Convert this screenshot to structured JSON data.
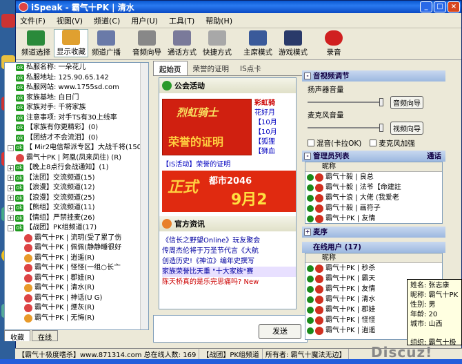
{
  "window": {
    "title": "iSpeak - 霸气十PK | 清水",
    "app_name": "iSpeak"
  },
  "menu": [
    "文件(F)",
    "视图(V)",
    "频道(C)",
    "用户(U)",
    "工具(T)",
    "帮助(H)"
  ],
  "toolbar": [
    "频道选择",
    "显示收藏",
    "频道广播",
    "音频向导",
    "通话方式",
    "快捷方式",
    "主席模式",
    "游戏模式",
    "录音"
  ],
  "left_tree": {
    "rows": [
      {
        "text": "私服名称: 一朵花儿",
        "kind": "ok",
        "indent": 1
      },
      {
        "text": "私服地址: 125.90.65.142",
        "kind": "ok",
        "indent": 1
      },
      {
        "text": "私服网站: www.1755sd.com",
        "kind": "ok",
        "indent": 1
      },
      {
        "text": "家族基地: 白日门",
        "kind": "ok",
        "indent": 1
      },
      {
        "text": "家族对手: 千将家族",
        "kind": "ok",
        "indent": 1
      },
      {
        "text": "注意事项: 对手TS有30上线率",
        "kind": "ok",
        "indent": 1
      },
      {
        "text": "【家族有你更精彩】(0)",
        "kind": "ok",
        "indent": 1
      },
      {
        "text": "【团结才不会流泪】(0)",
        "kind": "ok",
        "indent": 1
      },
      {
        "text": "【 Mir2电信帮派专区】大战千将(150)",
        "kind": "exp-minus",
        "indent": 0
      },
      {
        "text": "霸气十PK | 阿凰(凤来凤往) (R)",
        "kind": "user",
        "indent": 1
      },
      {
        "text": "【晚上8点行会战通知】(1)",
        "kind": "exp-plus",
        "indent": 0
      },
      {
        "text": "【法团】交流频道(15)",
        "kind": "exp-plus",
        "indent": 0
      },
      {
        "text": "【浪漫】交流频道(12)",
        "kind": "exp-plus",
        "indent": 0
      },
      {
        "text": "【浪漫】交流频道(25)",
        "kind": "exp-plus",
        "indent": 0
      },
      {
        "text": "【熊组】交流频道(11)",
        "kind": "exp-plus",
        "indent": 0
      },
      {
        "text": "【情组】严禁挂麦(26)",
        "kind": "exp-plus",
        "indent": 0
      },
      {
        "text": "【战团】PK组频道(17)",
        "kind": "exp-minus",
        "indent": 0
      },
      {
        "text": "霸气十PK | 流玥(受了累了伤",
        "kind": "user",
        "indent": 2
      },
      {
        "text": "霸气十PK | 佩佩(静静睡很好",
        "kind": "user",
        "indent": 2
      },
      {
        "text": "霸气十PK | 逍遥(R)",
        "kind": "user",
        "indent": 2
      },
      {
        "text": "霸气十PK | 怪怪(一组○长亠",
        "kind": "user",
        "indent": 2
      },
      {
        "text": "霸气十PK | 郡娃(R)",
        "kind": "user",
        "indent": 2
      },
      {
        "text": "霸气十PK | 清水(R)",
        "kind": "user",
        "indent": 2
      },
      {
        "text": "霸气十PK | 神话(U G)",
        "kind": "user",
        "indent": 2
      },
      {
        "text": "霸气十PK | 煙灰(R)",
        "kind": "user",
        "indent": 2
      },
      {
        "text": "霸气十PK | 无悔(R)",
        "kind": "user",
        "indent": 2
      }
    ],
    "tabs": [
      "收藏",
      "在线"
    ]
  },
  "center": {
    "tabs": [
      "起始页",
      "荣誉的证明",
      "IS点卡"
    ],
    "section1": "公会活动",
    "banner1_logo": "烈虹骑士",
    "banner1_text": "荣誉的证明",
    "links1": [
      "彩虹骑",
      "花好月",
      "【10月",
      "【10月",
      "【狐狸",
      "【狮血"
    ],
    "caption1": "【IS活动】荣誉的证明",
    "banner2_a": "都市2046",
    "banner2_b": "9月2",
    "banner2_c": "正式",
    "section2": "官方资讯",
    "news": [
      "《信长之野望Online》玩友聚会",
      "传周杰伦将于万圣节代言《大航",
      "创造历史!《神泣》编年史撰写",
      "家族荣誉比天重 \"十大家族\"赛",
      "陈天桥真的是乐完思痛吗? New"
    ],
    "send_label": "发送"
  },
  "right": {
    "av_title": "音视频调节",
    "speaker_label": "扬声器音量",
    "speaker_btn": "音频向导",
    "mic_label": "麦克风音量",
    "mic_btn": "视频向导",
    "mix_label": "混音(卡拉OK)",
    "boost_label": "麦克风加强",
    "admin_title": "管理员列表",
    "call_label": "通话",
    "nick_header": "昵称",
    "admins": [
      "霸气十毅 | 良总",
      "霸气十毅 | 法爷【命建註",
      "霸气十浪 | 大佬 (我爱老",
      "霸气十毅 | 画符子",
      "霸气十PK | 友情"
    ],
    "maitre_title": "麦序",
    "online_title": "在线用户 (17)",
    "online": [
      "霸气十PK | 秒杀",
      "霸气十PK | 霸天",
      "霸气十PK | 友情",
      "霸气十PK | 清水",
      "霸气十PK | 郡娃",
      "霸气十PK | 怪怪",
      "霸气十PK | 逍遥"
    ]
  },
  "tooltip": {
    "lines": [
      "姓名: 张志康",
      "昵称: 霸气十PK",
      "性别: 男",
      "年龄: 20",
      "城市: 山西",
      "",
      "组织: 霸气十极"
    ]
  },
  "status": [
    "【霸气十极度嗜杀】www.871314.com 总在线人数: 169",
    "【战团】PK组频道",
    "所有者: 霸气十魔法无边】"
  ],
  "watermark": "Discuz!"
}
